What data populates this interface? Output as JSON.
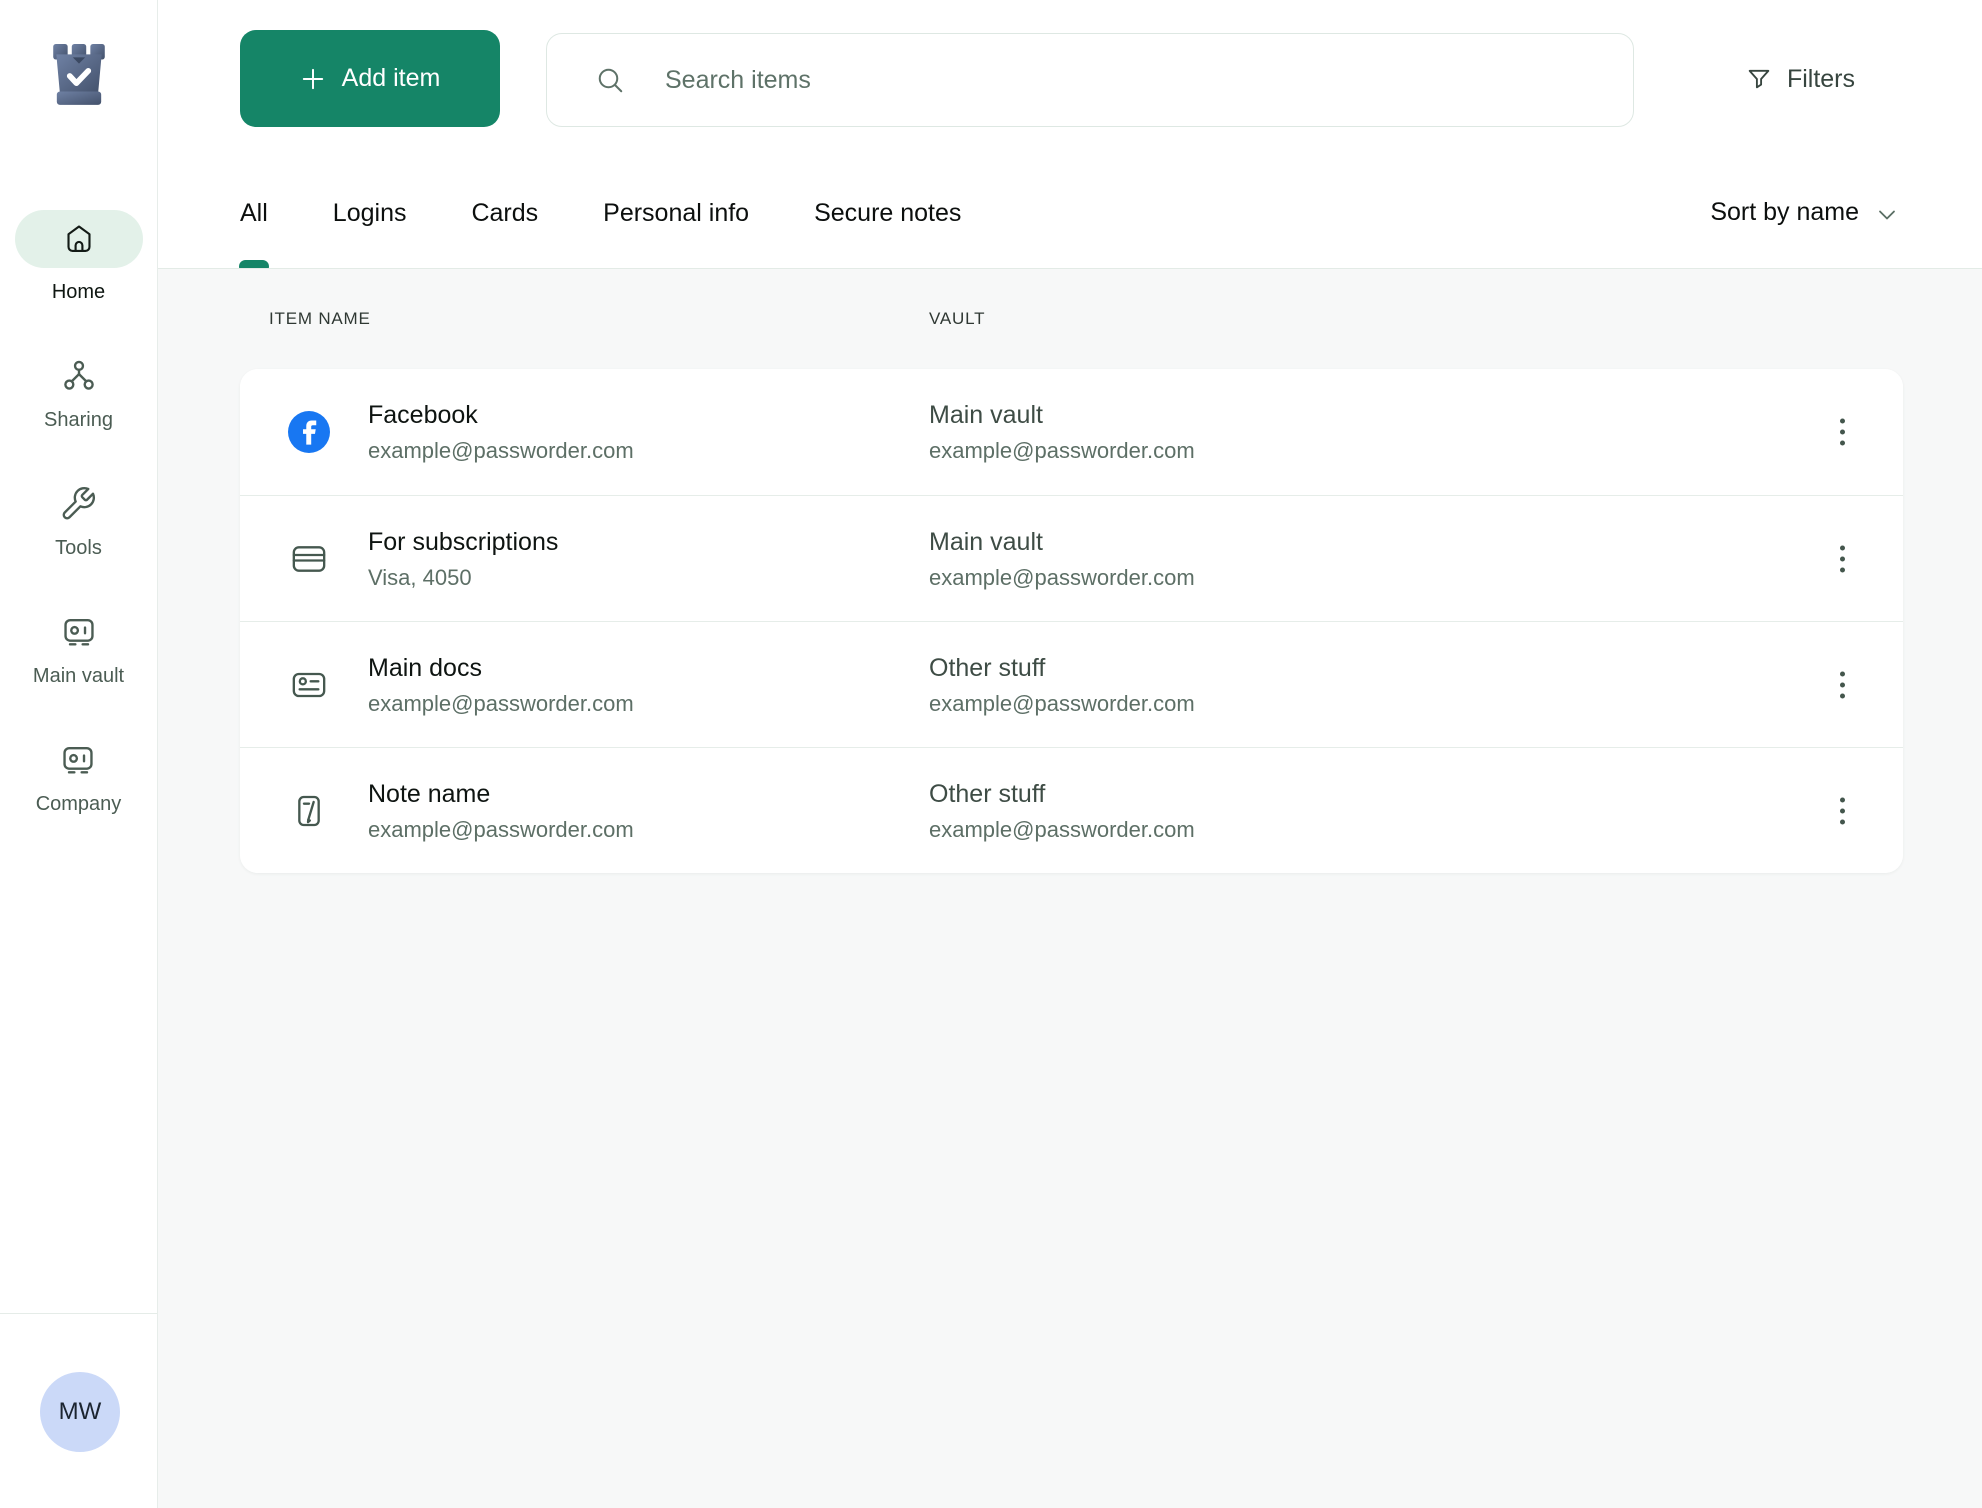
{
  "colors": {
    "accent_green": "#158567",
    "facebook_blue": "#1877F2",
    "avatar_bg": "#CBD9F8",
    "content_bg": "#F7F8F8"
  },
  "sidebar": {
    "items": [
      {
        "label": "Home",
        "icon": "home-icon",
        "active": true
      },
      {
        "label": "Sharing",
        "icon": "share-icon",
        "active": false
      },
      {
        "label": "Tools",
        "icon": "wrench-icon",
        "active": false
      },
      {
        "label": "Main vault",
        "icon": "safe-icon",
        "active": false
      },
      {
        "label": "Company",
        "icon": "safe-icon",
        "active": false
      }
    ],
    "avatar_initials": "MW"
  },
  "topbar": {
    "add_button_label": "Add item",
    "search_placeholder": "Search items",
    "filters_label": "Filters"
  },
  "tabs": [
    {
      "label": "All",
      "active": true
    },
    {
      "label": "Logins",
      "active": false
    },
    {
      "label": "Cards",
      "active": false
    },
    {
      "label": "Personal info",
      "active": false
    },
    {
      "label": "Secure notes",
      "active": false
    }
  ],
  "sort": {
    "label": "Sort by name"
  },
  "table": {
    "headers": [
      "ITEM NAME",
      "VAULT"
    ],
    "rows": [
      {
        "icon": "facebook-icon",
        "name": "Facebook",
        "subtitle": "example@passworder.com",
        "vault": "Main vault",
        "vault_subtitle": "example@passworder.com"
      },
      {
        "icon": "credit-card-icon",
        "name": "For subscriptions",
        "subtitle": "Visa, 4050",
        "vault": "Main vault",
        "vault_subtitle": "example@passworder.com"
      },
      {
        "icon": "id-card-icon",
        "name": "Main docs",
        "subtitle": "example@passworder.com",
        "vault": "Other stuff",
        "vault_subtitle": "example@passworder.com"
      },
      {
        "icon": "note-icon",
        "name": "Note name",
        "subtitle": "example@passworder.com",
        "vault": "Other stuff",
        "vault_subtitle": "example@passworder.com"
      }
    ]
  }
}
